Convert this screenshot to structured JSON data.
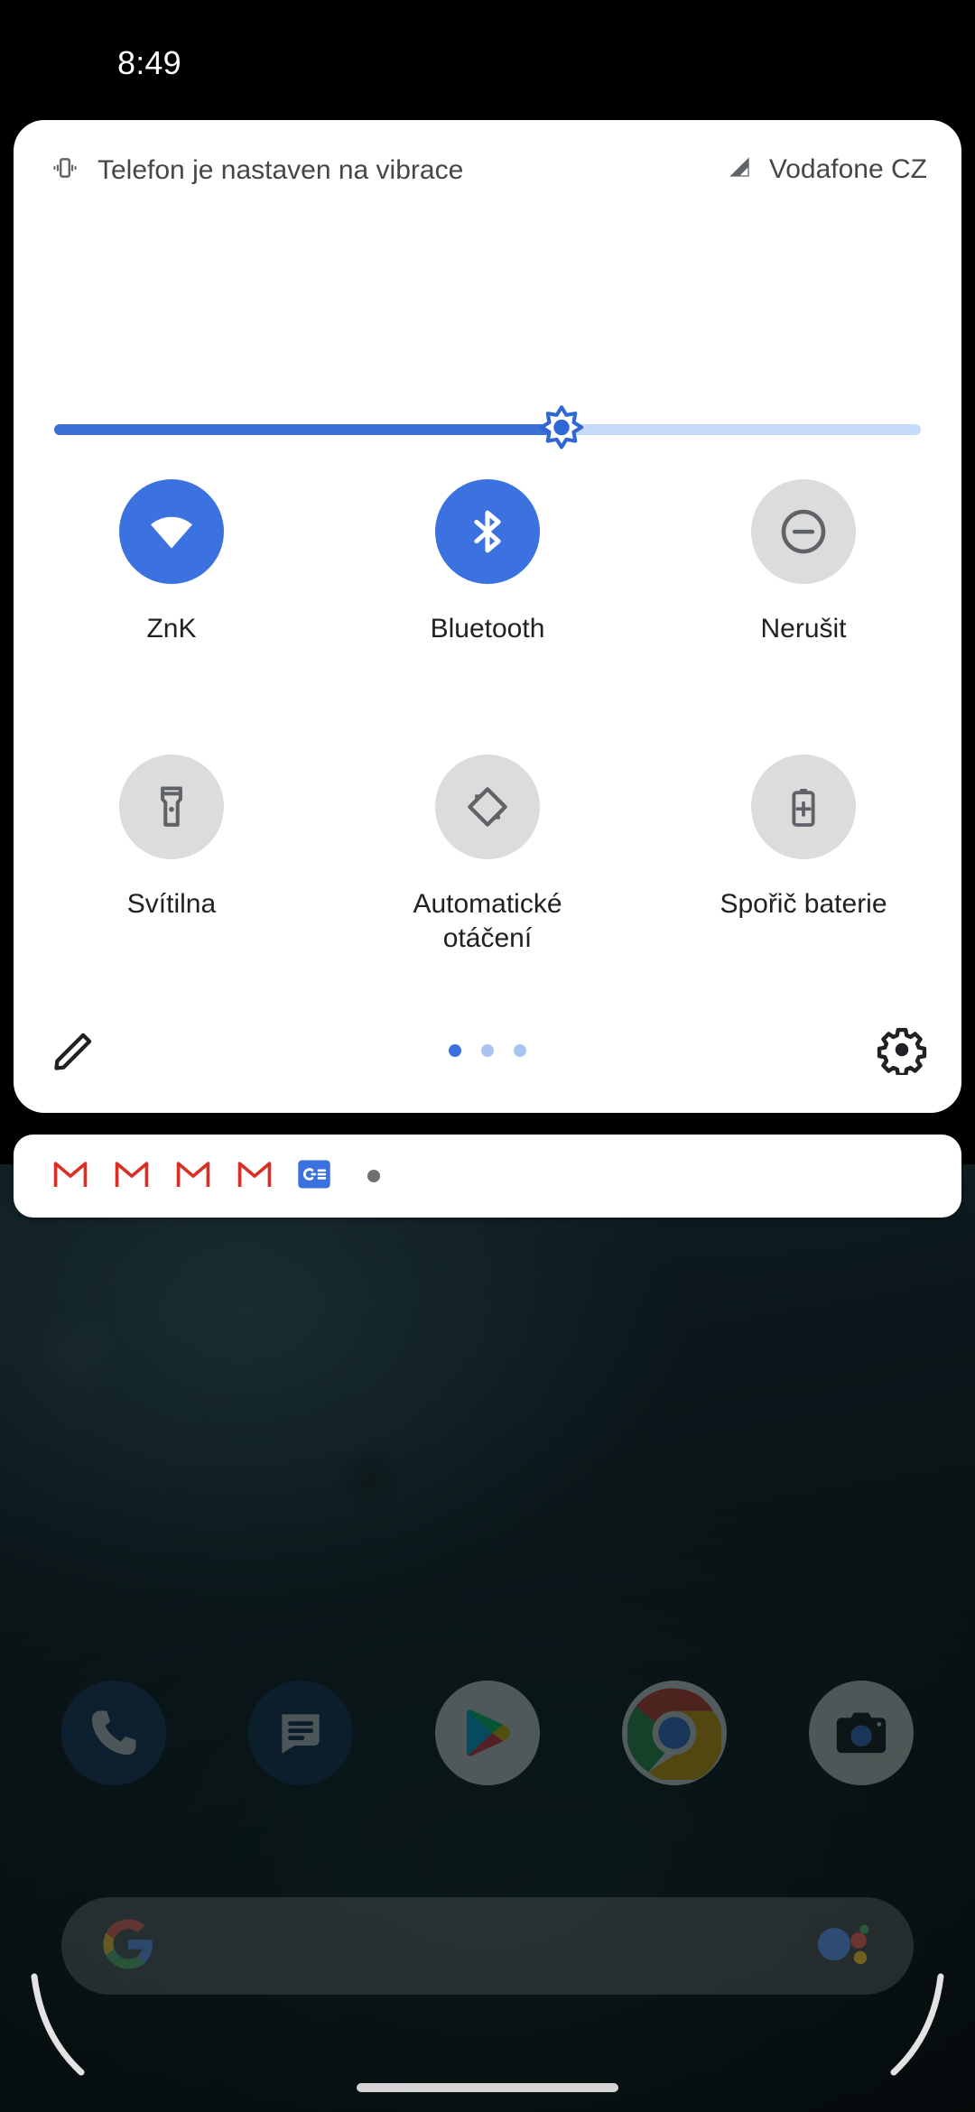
{
  "status_bar": {
    "clock": "8:49"
  },
  "quick_settings": {
    "header": {
      "vibrate_icon": "vibration-icon",
      "vibrate_text": "Telefon je nastaven na vibrace",
      "signal_icon": "signal-cellular-icon",
      "carrier": "Vodafone CZ"
    },
    "brightness": {
      "icon": "brightness-sun-icon",
      "value_percent": 58,
      "fill_color": "#3b6fd4",
      "track_color": "#c6dafb"
    },
    "tiles": [
      {
        "label": "ZnK",
        "icon": "wifi-icon",
        "state": "on",
        "active_color": "#3b72e0",
        "inactive_color": "#dcdcdc"
      },
      {
        "label": "Bluetooth",
        "icon": "bluetooth-icon",
        "state": "on",
        "active_color": "#3b72e0",
        "inactive_color": "#dcdcdc"
      },
      {
        "label": "Nerušit",
        "icon": "do-not-disturb-icon",
        "state": "off",
        "active_color": "#3b72e0",
        "inactive_color": "#dcdcdc"
      },
      {
        "label": "Svítilna",
        "icon": "flashlight-icon",
        "state": "off",
        "active_color": "#3b72e0",
        "inactive_color": "#dcdcdc"
      },
      {
        "label": "Automatické otáčení",
        "icon": "auto-rotate-icon",
        "state": "off",
        "active_color": "#3b72e0",
        "inactive_color": "#dcdcdc"
      },
      {
        "label": "Spořič baterie",
        "icon": "battery-saver-icon",
        "state": "off",
        "active_color": "#3b72e0",
        "inactive_color": "#dcdcdc"
      }
    ],
    "footer": {
      "edit_icon": "pencil-edit-icon",
      "settings_icon": "gear-settings-icon",
      "pages_total": 3,
      "page_active_index": 1,
      "dot_active_color": "#3b72e0",
      "dot_inactive_color": "#aac4f2"
    }
  },
  "notification_strip": {
    "icons": [
      "gmail-icon",
      "gmail-icon",
      "gmail-icon",
      "gmail-icon",
      "google-classroom-icon"
    ],
    "overflow_dot": "more-notifications-dot"
  },
  "home_screen": {
    "dock": [
      {
        "name": "phone-icon"
      },
      {
        "name": "messages-icon"
      },
      {
        "name": "play-store-icon"
      },
      {
        "name": "chrome-icon"
      },
      {
        "name": "camera-icon"
      }
    ],
    "search_bar": {
      "logo_icon": "google-g-icon",
      "assistant_icon": "google-assistant-icon"
    },
    "navigation": {
      "left_gesture": "back-gesture-arc",
      "right_gesture": "back-gesture-arc",
      "home_pill": "home-gesture-pill"
    }
  }
}
